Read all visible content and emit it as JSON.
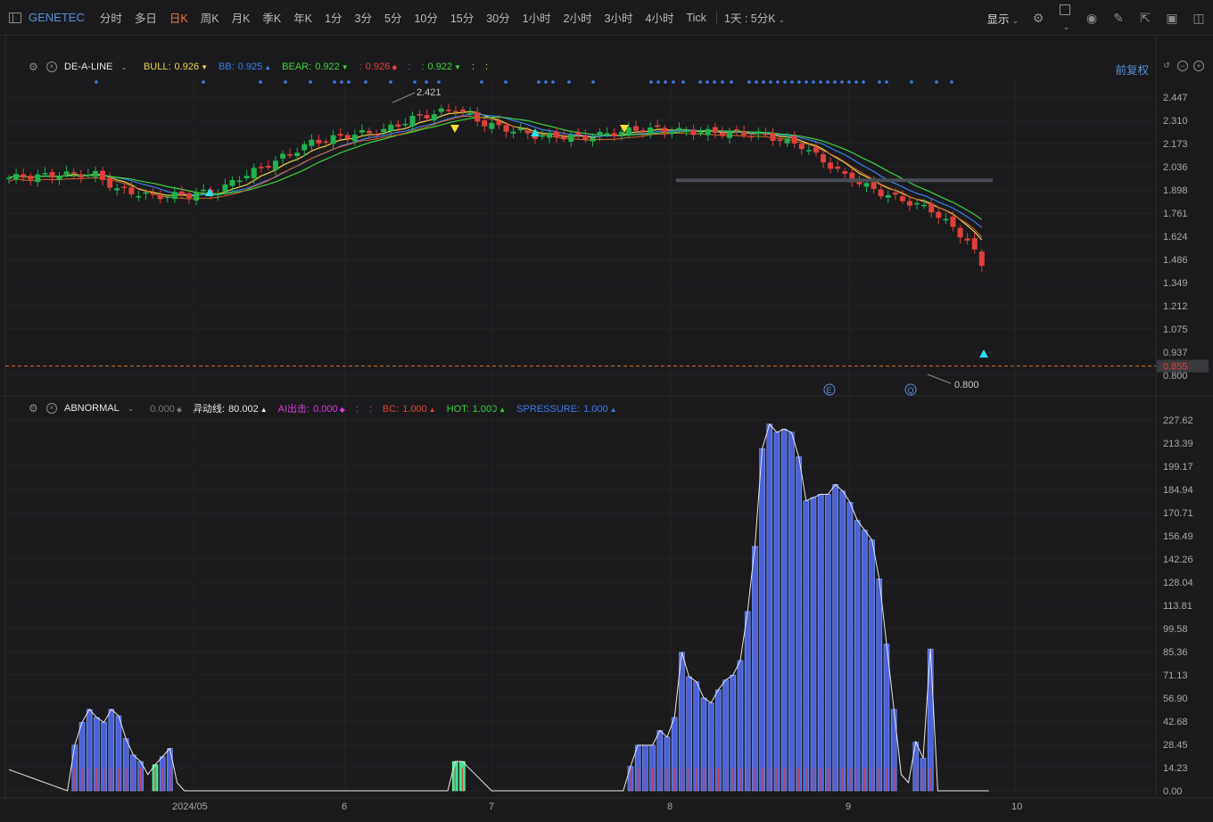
{
  "topbar": {
    "symbol": "GENETEC",
    "timeframes": [
      "分时",
      "多日",
      "日K",
      "周K",
      "月K",
      "季K",
      "年K",
      "1分",
      "3分",
      "5分",
      "10分",
      "15分",
      "30分",
      "1小时",
      "2小时",
      "3小时",
      "4小时",
      "Tick"
    ],
    "active_timeframe": "日K",
    "range_select": "1天 : 5分K",
    "display_label": "显示"
  },
  "main_indicator": {
    "name": "DE-A-LINE",
    "items": [
      {
        "label": "BULL:",
        "value": "0.926",
        "color": "#e8d44a",
        "dir": "down"
      },
      {
        "label": "BB:",
        "value": "0.925",
        "color": "#3d7de8",
        "dir": "up"
      },
      {
        "label": "BEAR:",
        "value": "0.922",
        "color": "#3fd13f",
        "dir": "down"
      },
      {
        "label": ":",
        "value": "0.926",
        "color": "#e0403a",
        "dir": "flat"
      },
      {
        "label": ":",
        "value": "",
        "color": "#3d7de8",
        "dir": ""
      },
      {
        "label": ":",
        "value": "0.922",
        "color": "#3fd13f",
        "dir": "down"
      },
      {
        "label": ":",
        "value": "",
        "color": "#e8d44a",
        "dir": ""
      },
      {
        "label": ":",
        "value": "",
        "color": "#e8d44a",
        "dir": ""
      }
    ],
    "adjust_label": "前复权"
  },
  "sub_indicator": {
    "name": "ABNORMAL",
    "items": [
      {
        "label": "",
        "value": "0.000",
        "color": "#777777",
        "dir": "flat"
      },
      {
        "label": "异动线:",
        "value": "80.002",
        "color": "#e6e6e6",
        "dir": "up"
      },
      {
        "label": "AI出击:",
        "value": "0.000",
        "color": "#d63ad6",
        "dir": "flat"
      },
      {
        "label": ":",
        "value": "",
        "color": "#d63ad6",
        "dir": ""
      },
      {
        "label": ":",
        "value": "",
        "color": "#d63ad6",
        "dir": ""
      },
      {
        "label": "BC:",
        "value": "1.000",
        "color": "#e0403a",
        "dir": "up"
      },
      {
        "label": "HOT:",
        "value": "1.000",
        "color": "#3fd13f",
        "dir": "up"
      },
      {
        "label": "SPRESSURE:",
        "value": "1.000",
        "color": "#3d7de8",
        "dir": "up"
      }
    ]
  },
  "chart_data": [
    {
      "type": "candlestick",
      "title": "DE-A-LINE",
      "price_axis_ticks": [
        "2.447",
        "2.310",
        "2.173",
        "2.036",
        "1.898",
        "1.761",
        "1.624",
        "1.486",
        "1.349",
        "1.212",
        "1.075",
        "0.937",
        "0.800"
      ],
      "ylim": [
        0.78,
        2.52
      ],
      "last_price": "0.855",
      "last_price_color": "#e0403a",
      "high_label": "2.421",
      "low_label": "0.800",
      "resistance_level": 1.955,
      "event_markers": [
        "E",
        "Q"
      ],
      "x_labels": [
        "2024/05",
        "6",
        "7",
        "8",
        "9",
        "10"
      ],
      "series": [
        {
          "name": "BULL",
          "color": "#e8d44a"
        },
        {
          "name": "BB",
          "color": "#3d7de8"
        },
        {
          "name": "BEAR",
          "color": "#3fd13f"
        }
      ],
      "up_color": "#22b14c",
      "down_color": "#e0403a"
    },
    {
      "type": "bar",
      "title": "ABNORMAL",
      "y_axis_ticks": [
        "227.62",
        "213.39",
        "199.17",
        "184.94",
        "170.71",
        "156.49",
        "142.26",
        "128.04",
        "113.81",
        "99.58",
        "85.36",
        "71.13",
        "56.90",
        "42.68",
        "28.45",
        "14.23",
        "0.00"
      ],
      "ylim": [
        0,
        227.62
      ],
      "bar_color": "#4a62d8",
      "hot_color": "#3de08a",
      "line_color": "#e8e8e8"
    }
  ]
}
